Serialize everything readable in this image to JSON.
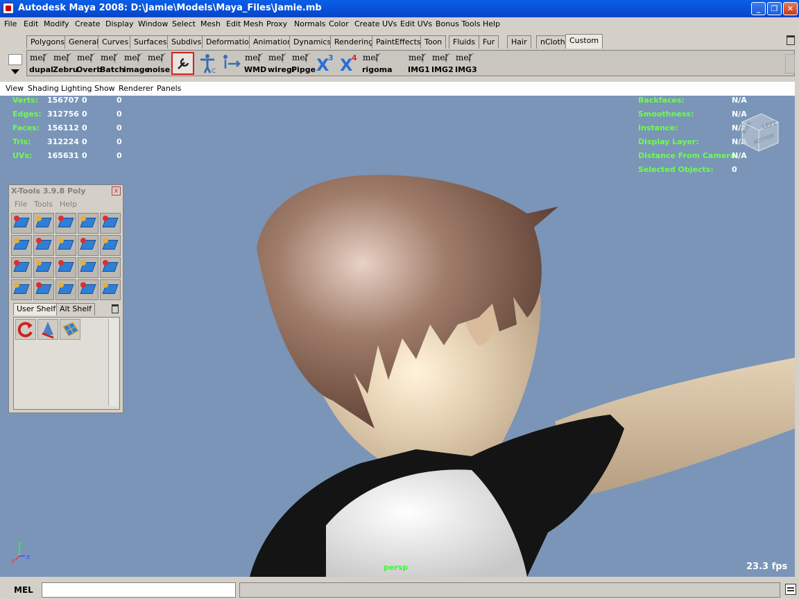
{
  "window": {
    "title": "Autodesk Maya 2008: D:\\Jamie\\Models\\Maya_Files\\Jamie.mb"
  },
  "menus": [
    "File",
    "Edit",
    "Modify",
    "Create",
    "Display",
    "Window",
    "Select",
    "Mesh",
    "Edit Mesh",
    "Proxy",
    "Normals",
    "Color",
    "Create UVs",
    "Edit UVs",
    "Bonus Tools",
    "Help"
  ],
  "shelf_tabs": [
    "Polygons",
    "General",
    "Curves",
    "Surfaces",
    "Subdivs",
    "Deformation",
    "Animation",
    "Dynamics",
    "Rendering",
    "PaintEffects",
    "Toon",
    "Fluids",
    "Fur",
    "Hair",
    "nCloth",
    "Custom"
  ],
  "shelf_active": "Custom",
  "shelf_buttons": [
    "dupal",
    "Zebru",
    "Overb",
    "Batch",
    "image",
    "noise",
    "",
    "",
    "",
    "WMD",
    "wiregi",
    "Pipge",
    "",
    "",
    "rigoma",
    "IMG1",
    "IMG2",
    "IMG3"
  ],
  "shelf_mel_text": "mel",
  "panel_menu": [
    "View",
    "Shading",
    "Lighting",
    "Show",
    "Renderer",
    "Panels"
  ],
  "hud_left": [
    {
      "label": "Verts:",
      "a": "156707",
      "b": "0",
      "c": "0"
    },
    {
      "label": "Edges:",
      "a": "312756",
      "b": "0",
      "c": "0"
    },
    {
      "label": "Faces:",
      "a": "156112",
      "b": "0",
      "c": "0"
    },
    {
      "label": "Tris:",
      "a": "312224",
      "b": "0",
      "c": "0"
    },
    {
      "label": "UVs:",
      "a": "165631",
      "b": "0",
      "c": "0"
    }
  ],
  "hud_right": [
    {
      "label": "Backfaces:",
      "value": "N/A"
    },
    {
      "label": "Smoothness:",
      "value": "N/A"
    },
    {
      "label": "Instance:",
      "value": "N/A"
    },
    {
      "label": "Display Layer:",
      "value": "N/A"
    },
    {
      "label": "Distance From Camera:",
      "value": "N/A"
    },
    {
      "label": "Selected Objects:",
      "value": "0"
    }
  ],
  "viewcube": {
    "left": "LEFT",
    "back": "BACK",
    "bottom": "BOTTOM"
  },
  "camera_label": "persp",
  "fps": "23.3 fps",
  "axis": {
    "y": "y",
    "x": "x",
    "z": "z"
  },
  "xtools": {
    "title": "X-Tools 3.9.8 Poly",
    "close": "x",
    "menu": [
      "File",
      "Tools",
      "Help"
    ],
    "tabs": [
      "User Shelf",
      "Alt Shelf"
    ]
  },
  "command_line": {
    "label": "MEL",
    "value": ""
  },
  "colors": {
    "viewport_bg": "#7a95b7",
    "hud_green": "#6cff4a",
    "hair": "#8a6a58",
    "skin": "#e2cfb0",
    "shirt_dark": "#121212",
    "shirt_white": "#f4f4f4"
  }
}
